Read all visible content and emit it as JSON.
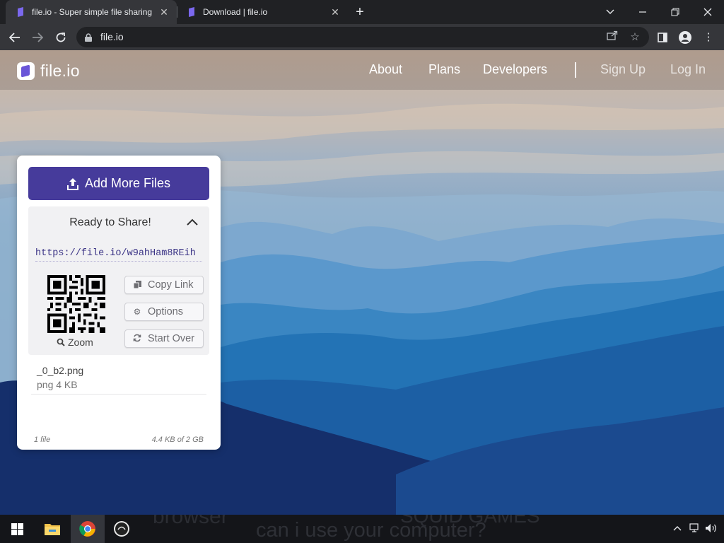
{
  "browser": {
    "tabs": [
      {
        "title": "file.io - Super simple file sharing",
        "close": "✕",
        "active": true
      },
      {
        "title": "Download | file.io",
        "close": "✕",
        "active": false
      }
    ],
    "new_tab_icon": "plus-icon",
    "window_controls": [
      "chevron-down-icon",
      "minimize-icon",
      "restore-icon",
      "close-icon"
    ],
    "nav_icons": [
      "back-arrow-icon",
      "forward-arrow-icon",
      "reload-icon"
    ],
    "address": "file.io",
    "toolbar_icons": [
      "share-icon",
      "star-icon",
      "side-panel-icon",
      "profile-icon",
      "menu-dots-icon"
    ]
  },
  "site": {
    "logo_text": "file.io",
    "nav": {
      "about": "About",
      "plans": "Plans",
      "developers": "Developers",
      "signup": "Sign Up",
      "login": "Log In"
    }
  },
  "panel": {
    "add_button": "Add More Files",
    "status": "Ready to Share!",
    "share_url": "https://file.io/w9ahHam8REih",
    "zoom_label": "Zoom",
    "actions": {
      "copy": "Copy Link",
      "options": "Options",
      "start_over": "Start Over"
    },
    "file": {
      "name": "_0_b2.png",
      "meta": "png 4 KB"
    },
    "footer": {
      "count": "1 file",
      "usage": "4.4 KB of 2 GB"
    }
  },
  "taskbar": {
    "overlay_text": [
      "browser",
      "can i use your computer?",
      "SQUID GAMES"
    ],
    "apps": [
      "windows-start-icon",
      "file-explorer-icon",
      "chrome-icon",
      "app-icon"
    ],
    "tray_icons": [
      "chevron-up-icon",
      "network-icon",
      "volume-icon"
    ]
  },
  "colors": {
    "accent": "#463b9b",
    "link": "#3b3486",
    "chrome_dark": "#202124",
    "chrome_toolbar": "#35363a"
  }
}
